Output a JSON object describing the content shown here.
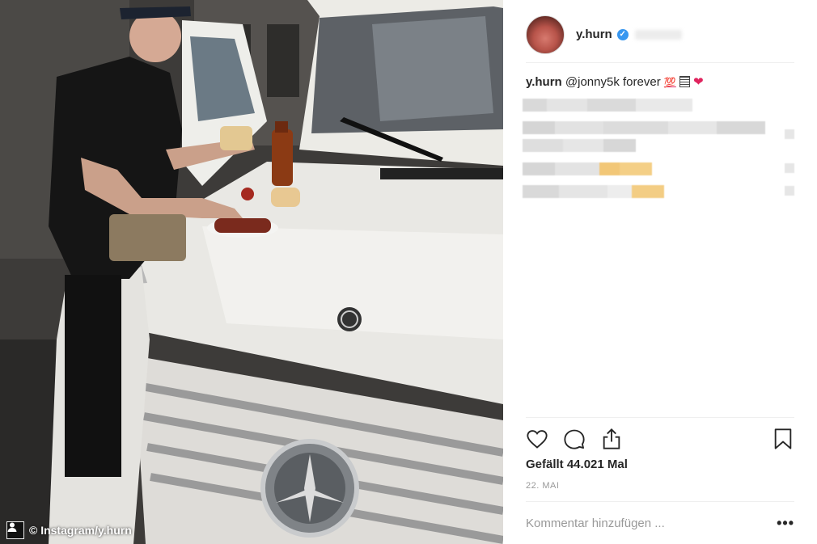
{
  "photo": {
    "credit": "© Instagram/y.hurn",
    "alt_subject": "man eating sausage on white mercedes hood"
  },
  "profile": {
    "username": "y.hurn",
    "verified": true
  },
  "caption": {
    "username": "y.hurn",
    "mention": "@jonny5k",
    "text": "forever",
    "emoji_hundred": "💯"
  },
  "stats": {
    "likes": "Gefällt 44.021 Mal",
    "date": "22. MAI"
  },
  "comment": {
    "placeholder": "Kommentar hinzufügen ...",
    "more": "•••"
  },
  "colors": {
    "accent": "#3897f0",
    "heart": "#e0245e",
    "text": "#262626",
    "muted": "#999999",
    "divider": "#efefef"
  }
}
